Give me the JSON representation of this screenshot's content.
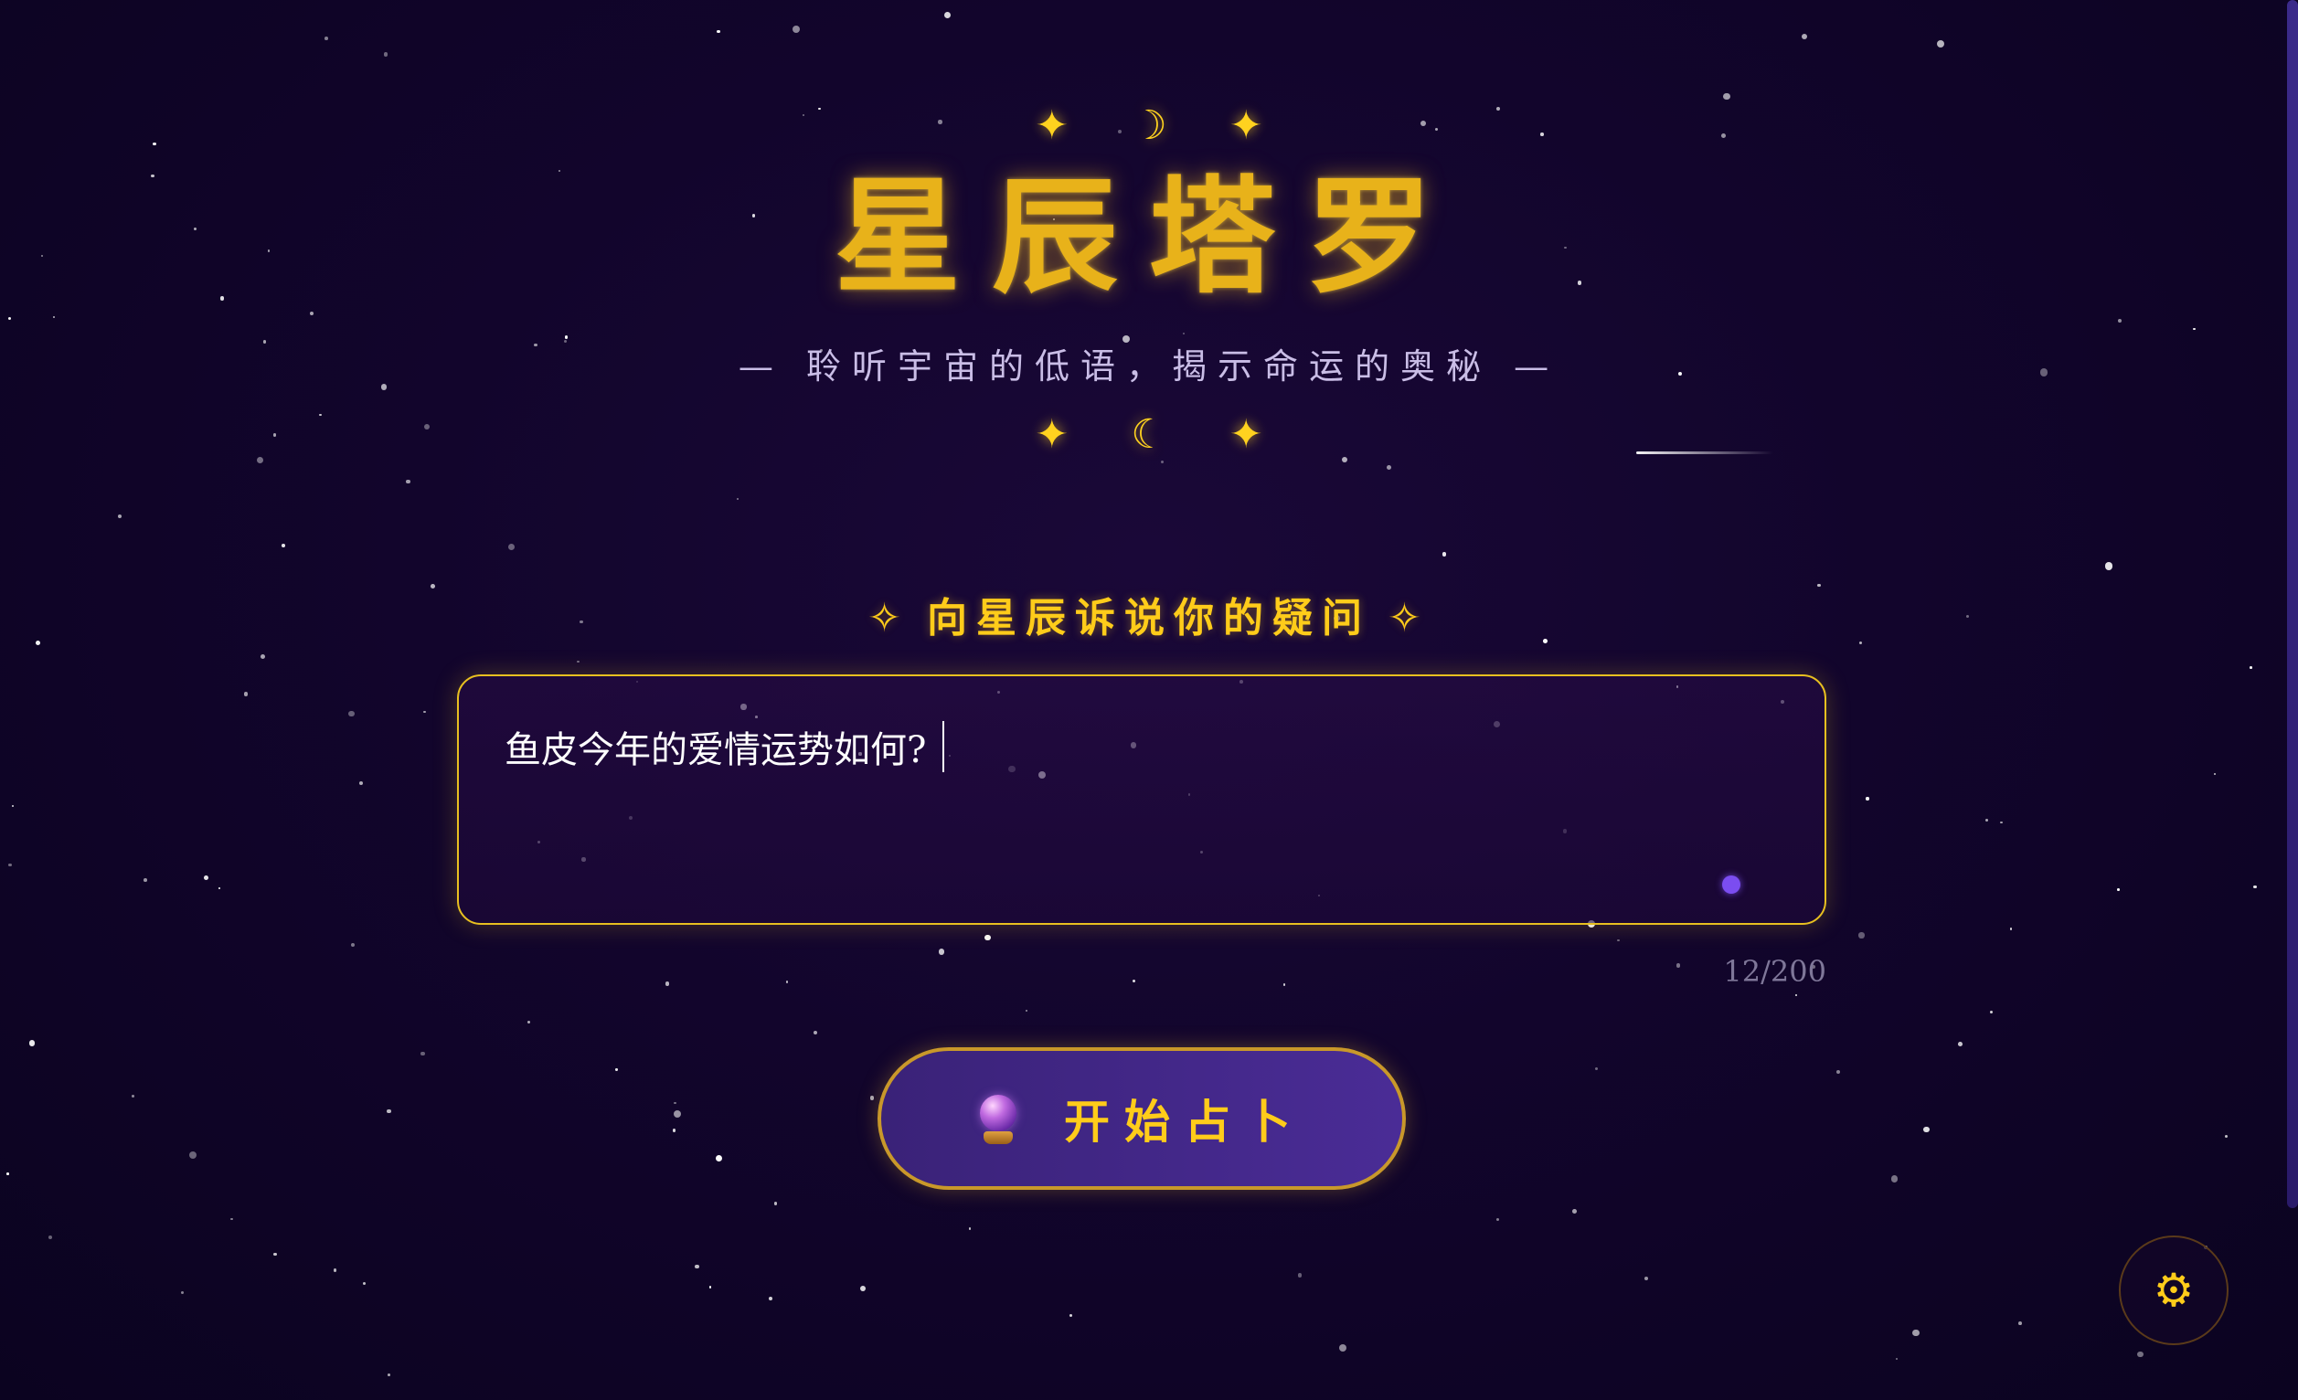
{
  "app": {
    "title": "星辰塔罗",
    "subtitle": "— 聆听宇宙的低语，揭示命运的奥秘 —"
  },
  "ornaments": {
    "top": [
      "✦",
      "☽",
      "✦"
    ],
    "bottom": [
      "✦",
      "☾",
      "✦"
    ]
  },
  "prompt": {
    "label": "向星辰诉说你的疑问",
    "spark_left": "✧",
    "spark_right": "✧"
  },
  "question": {
    "value": "鱼皮今年的爱情运势如何?",
    "char_count": "12/200"
  },
  "action": {
    "button_label": "开始占卜",
    "icon": "crystal-ball-icon"
  },
  "settings": {
    "icon": "gear-icon",
    "glyph": "⚙"
  },
  "colors": {
    "accent_gold": "#ffcc1a",
    "title_gold": "#e8b21a",
    "background": "#12052c",
    "button_purple": "#4a2c96",
    "dot_purple": "#7b4df0"
  }
}
